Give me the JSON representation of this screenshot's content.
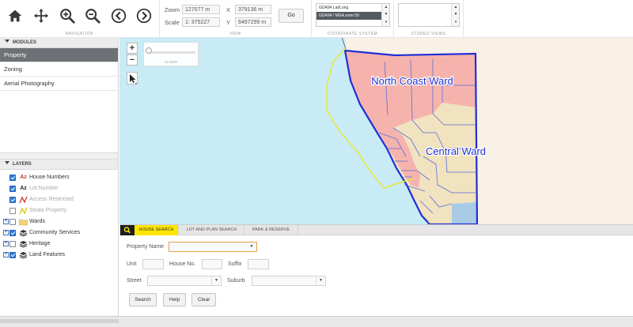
{
  "toolbar": {
    "navigation": {
      "caption": "NAVIGATION",
      "buttons": [
        "home-icon",
        "pan-move-icon",
        "zoom-in-icon",
        "zoom-out-icon",
        "back-icon",
        "forward-icon"
      ],
      "accent": "#1f1f1f"
    },
    "view": {
      "caption": "VIEW",
      "zoom_label": "Zoom",
      "zoom_value": "127077 m",
      "scale_label": "Scale",
      "scale_value": "1: 375227",
      "x_label": "X",
      "x_value": "379136 m",
      "y_label": "Y",
      "y_value": "6497299 m",
      "go_label": "Go"
    },
    "coordinate_system": {
      "caption": "COORDINATE SYSTEM",
      "options": [
        "GDA94 Lat/Long",
        "GDA94 / MGA zone 50"
      ],
      "selected_index": 1
    },
    "stored_views": {
      "caption": "STORED VIEWS"
    }
  },
  "modules": {
    "header": "MODULES",
    "items": [
      "Property",
      "Zoning",
      "Aerial Photography"
    ],
    "active": "Property"
  },
  "layers": {
    "header": "LAYERS",
    "items": [
      {
        "label": "House Numbers",
        "checked": true,
        "icon": "text-az-icon",
        "expand": false,
        "dim": false
      },
      {
        "label": "Lot Number",
        "checked": true,
        "icon": "text-az-icon",
        "expand": false,
        "dim": true
      },
      {
        "label": "Access Restricted",
        "checked": true,
        "icon": "line-red-icon",
        "expand": false,
        "dim": true
      },
      {
        "label": "Strata Property",
        "checked": false,
        "icon": "line-yellow-icon",
        "expand": false,
        "dim": true
      },
      {
        "label": "Wards",
        "checked": false,
        "icon": "folder-icon",
        "expand": true,
        "dim": false
      },
      {
        "label": "Community Services",
        "checked": true,
        "icon": "layers-stack-icon",
        "expand": true,
        "dim": false
      },
      {
        "label": "Heritage",
        "checked": false,
        "icon": "layers-stack-icon",
        "expand": true,
        "dim": false
      },
      {
        "label": "Land Features",
        "checked": true,
        "icon": "layers-stack-icon",
        "expand": true,
        "dim": false
      }
    ]
  },
  "map": {
    "slider_label": "SLIDER",
    "wards": [
      {
        "label": "North Coast Ward",
        "color": "#f6b3ad"
      },
      {
        "label": "Central Ward",
        "color": "#f1e2c0"
      }
    ],
    "colors": {
      "ocean": "#c8ebf6",
      "land": "#f9f1e6",
      "boundary": "#1f2fd6",
      "strata": "#f2f23a",
      "south": "#a9cbe6"
    }
  },
  "search": {
    "tabs": [
      "HOUSE SEARCH",
      "LOT AND PLAN SEARCH",
      "PARK & RESERVE"
    ],
    "active_tab": "HOUSE SEARCH",
    "fields": {
      "property_name": "Property Name",
      "unit": "Unit",
      "house_no": "House No.",
      "suffix": "Suffix",
      "street": "Street",
      "suburb": "Suburb"
    },
    "buttons": {
      "search": "Search",
      "help": "Help",
      "clear": "Clear"
    },
    "accent": "#ffe600"
  }
}
